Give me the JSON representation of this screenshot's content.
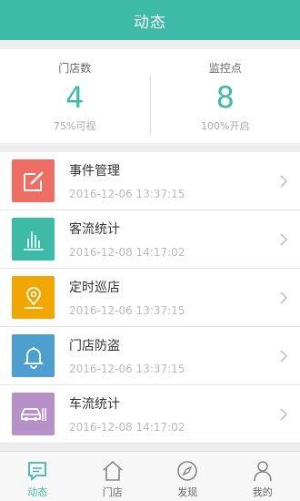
{
  "header": {
    "title": "动态"
  },
  "stats": [
    {
      "label": "门店数",
      "value": "4",
      "sub": "75%可视"
    },
    {
      "label": "监控点",
      "value": "8",
      "sub": "100%开启"
    }
  ],
  "list": [
    {
      "title": "事件管理",
      "time": "2016-12-06 13:37:15",
      "icon": "edit-icon",
      "color": "#ef6e63"
    },
    {
      "title": "客流统计",
      "time": "2016-12-08 14:17:02",
      "icon": "bar-chart-icon",
      "color": "#3dbaa8"
    },
    {
      "title": "定时巡店",
      "time": "2016-12-06 13:37:15",
      "icon": "map-pin-icon",
      "color": "#f2a600"
    },
    {
      "title": "门店防盗",
      "time": "2016-12-06 13:37:15",
      "icon": "bell-icon",
      "color": "#4d9fd0"
    },
    {
      "title": "车流统计",
      "time": "2016-12-08 14:17:02",
      "icon": "car-icon",
      "color": "#b691c8"
    }
  ],
  "tabs": [
    {
      "label": "动态",
      "icon": "message-icon",
      "active": true
    },
    {
      "label": "门店",
      "icon": "home-icon",
      "active": false
    },
    {
      "label": "发现",
      "icon": "compass-icon",
      "active": false
    },
    {
      "label": "我的",
      "icon": "user-icon",
      "active": false
    }
  ],
  "colors": {
    "accent": "#3dbaa8"
  }
}
